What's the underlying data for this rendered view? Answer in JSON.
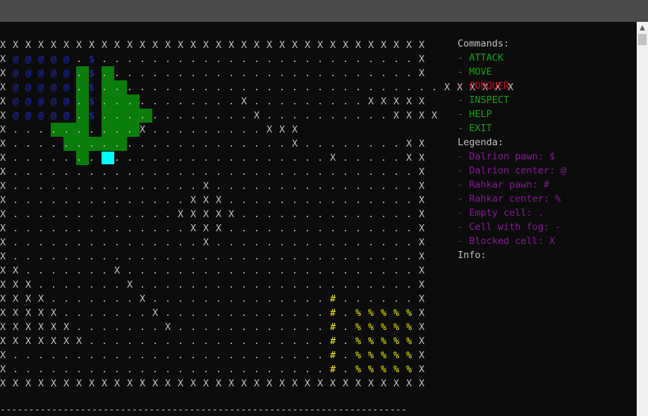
{
  "grid": [
    "XXXXXXXXXXXXXXXXXXXXXXXXXXXXXXXXXX",
    "X@@@@@.$.........................X",
    "X@@@@@.$.........................X",
    "X@@@@@.$...........................XXXXXX",
    "X@@@@@.$...........X.........XXXXX",
    "X@@@@@.$............X..........XXXX",
    "X..........X.........XXX",
    "X......................X........XX",
    "X.........................X.....XX",
    "X................................X",
    "X...............X................X",
    "X..............XXX...............X",
    "X.............XXXXX..............X",
    "X..............XXX...............X",
    "X...............X................X",
    "X................................X",
    "XX.......X.......................X",
    "XXX.......X......................X",
    "XXXX.......X..............#......X",
    "XXXXX.......X.............#.%%%%%X",
    "XXXXXX.......X............#.%%%%%X",
    "XXXXXXX...................#.%%%%%X",
    "X.........................#.%%%%%X",
    "X.........................#.%%%%%X",
    "XXXXXXXXXXXXXXXXXXXXXXXXXXXXXXXXXX"
  ],
  "panel": {
    "commands_title": "Commands:",
    "commands": [
      {
        "text": "- ATTACK",
        "color": "#13a10e"
      },
      {
        "text": "- MOVE",
        "color": "#13a10e"
      },
      {
        "text": "- CONQUER",
        "color": "#c50f1f"
      },
      {
        "text": "- INSPECT",
        "color": "#13a10e"
      },
      {
        "text": "- HELP",
        "color": "#13a10e"
      },
      {
        "text": "- EXIT",
        "color": "#13a10e"
      }
    ],
    "legend_title": "Legenda:",
    "legend": [
      "- Dalrion pawn: $",
      "- Dalrion center: @",
      "- Rahkar pawn: #",
      "- Rahkar center: %",
      "- Empty cell: .",
      "- Cell with fog: -",
      "- Blocked cell: X"
    ],
    "info_title": "Info:"
  },
  "separator": "-----------------------------------------------------------------------",
  "colors": {
    "dalrion": "#1d2ecf",
    "rahkar": "#f2f200",
    "territory": "#0b7d0b",
    "cursor": "#00ffff",
    "legend": "#881798"
  }
}
